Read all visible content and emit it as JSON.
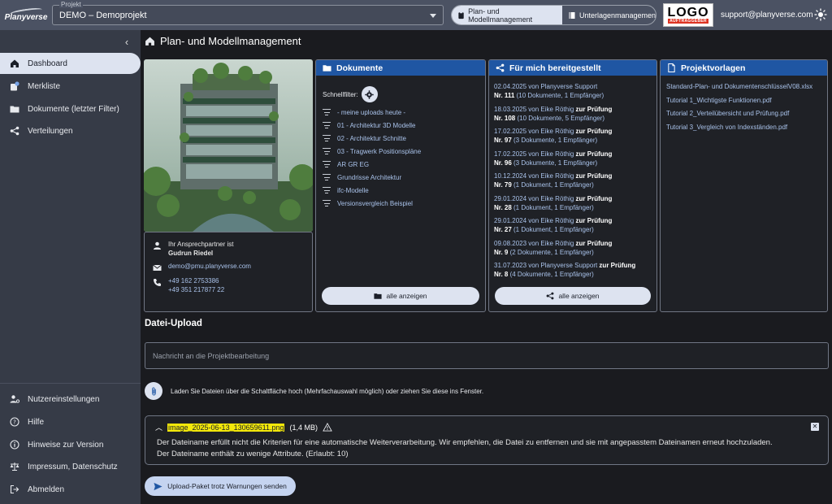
{
  "brand": {
    "name": "Planyverse"
  },
  "project": {
    "label": "Projekt",
    "value": "DEMO – Demoprojekt"
  },
  "modes": [
    {
      "label": "Plan- und Modellmanagement",
      "icon": "clipboard-icon",
      "active": true
    },
    {
      "label": "Unterlagenmanagement",
      "icon": "book-icon",
      "active": false
    }
  ],
  "client_logo": {
    "text": "LOGO",
    "sub": "AUFTRAGGEBER"
  },
  "support_email": "support@planyverse.com",
  "sidebar": {
    "top": [
      {
        "label": "Dashboard",
        "icon": "home-icon",
        "active": true
      },
      {
        "label": "Merkliste",
        "icon": "bookmark-icon",
        "active": false
      },
      {
        "label": "Dokumente (letzter Filter)",
        "icon": "folder-icon",
        "active": false
      },
      {
        "label": "Verteilungen",
        "icon": "share-icon",
        "active": false
      }
    ],
    "bottom": [
      {
        "label": "Nutzereinstellungen",
        "icon": "user-settings-icon"
      },
      {
        "label": "Hilfe",
        "icon": "help-icon"
      },
      {
        "label": "Hinweise zur Version",
        "icon": "info-icon"
      },
      {
        "label": "Impressum, Datenschutz",
        "icon": "scale-icon"
      },
      {
        "label": "Abmelden",
        "icon": "logout-icon"
      }
    ]
  },
  "page": {
    "title": "Plan- und Modellmanagement"
  },
  "contact": {
    "intro": "Ihr Ansprechpartner ist",
    "name": "Gudrun Riedel",
    "email": "demo@pmu.planyverse.com",
    "phone1": "+49 162 2753386",
    "phone2": "+49 351 217877 22"
  },
  "documents": {
    "title": "Dokumente",
    "quickfilter_label": "Schnellfilter:",
    "filters": [
      "- meine uploads heute -",
      "01 - Architektur 3D Modelle",
      "02 - Architektur Schnitte",
      "03 - Tragwerk Positionspläne",
      "AR GR EG",
      "Grundrisse Architektur",
      "ifc-Modelle",
      "Versionsvergleich Beispiel"
    ],
    "show_all": "alle anzeigen"
  },
  "shared": {
    "title": "Für mich bereitgestellt",
    "items": [
      {
        "date": "02.04.2025 von Planyverse Support",
        "status": "",
        "nr": "Nr. 111",
        "detail": " (10 Dokumente, 1 Empfänger)"
      },
      {
        "date": "18.03.2025 von Eike Röthig",
        "status": " zur Prüfung",
        "nr": "Nr. 108",
        "detail": " (10 Dokumente, 5 Empfänger)"
      },
      {
        "date": "17.02.2025 von Eike Röthig",
        "status": " zur Prüfung",
        "nr": "Nr. 97",
        "detail": " (3 Dokumente, 1 Empfänger)"
      },
      {
        "date": "17.02.2025 von Eike Röthig",
        "status": " zur Prüfung",
        "nr": "Nr. 96",
        "detail": " (3 Dokumente, 1 Empfänger)"
      },
      {
        "date": "10.12.2024 von Eike Röthig",
        "status": " zur Prüfung",
        "nr": "Nr. 79",
        "detail": " (1 Dokument, 1 Empfänger)"
      },
      {
        "date": "29.01.2024 von Eike Röthig",
        "status": " zur Prüfung",
        "nr": "Nr. 28",
        "detail": " (1 Dokument, 1 Empfänger)"
      },
      {
        "date": "29.01.2024 von Eike Röthig",
        "status": " zur Prüfung",
        "nr": "Nr. 27",
        "detail": " (1 Dokument, 1 Empfänger)"
      },
      {
        "date": "09.08.2023 von Eike Röthig",
        "status": " zur Prüfung",
        "nr": "Nr. 9",
        "detail": " (2 Dokumente, 1 Empfänger)"
      },
      {
        "date": "31.07.2023 von Planyverse Support",
        "status": " zur Prüfung",
        "nr": "Nr. 8",
        "detail": " (4 Dokumente, 1 Empfänger)"
      }
    ],
    "show_all": "alle anzeigen"
  },
  "templates": {
    "title": "Projektvorlagen",
    "items": [
      "Standard-Plan- und DokumentenschlüsselV08.xlsx",
      "Tutorial 1_Wichtigste Funktionen.pdf",
      "Tutorial 2_Verteilübersicht und Prüfung.pdf",
      "Tutorial 3_Vergleich von Indexständen.pdf"
    ]
  },
  "upload": {
    "title": "Datei-Upload",
    "message_placeholder": "Nachricht an die Projektbearbeitung",
    "hint": "Laden Sie Dateien über die Schaltfläche hoch (Mehrfachauswahl möglich) oder ziehen Sie diese ins Fenster.",
    "file": {
      "name": "image_2025-06-13_130659611.png",
      "size": "(1,4 MB)",
      "warning1": "Der Dateiname erfüllt nicht die Kriterien für eine automatische Weiterverarbeitung. Wir empfehlen, die Datei zu entfernen und sie mit angepasstem Dateinamen erneut hochzuladen.",
      "warning2": "Der Dateiname enthält zu wenige Attribute. (Erlaubt: 10)"
    },
    "send_label": "Upload-Paket trotz Warnungen senden"
  },
  "colors": {
    "accent": "#1f56a3",
    "active_bg": "#dde3f0",
    "link": "#a9c2ea",
    "highlight": "#f3e80a"
  }
}
